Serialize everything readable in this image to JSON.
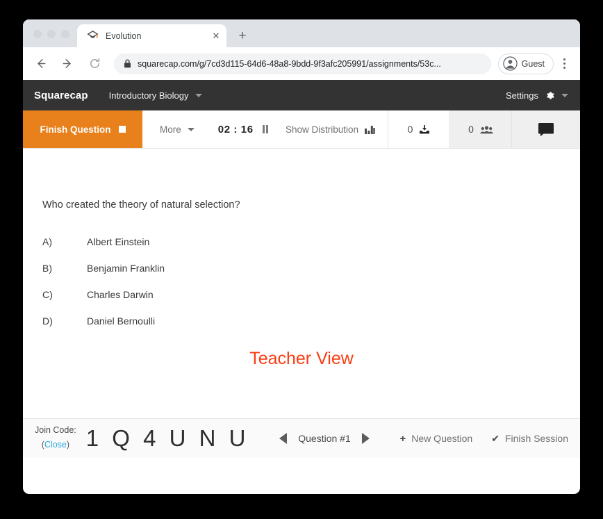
{
  "browser": {
    "tab": {
      "title": "Evolution",
      "favicon_name": "squarecap-cap-icon",
      "close_label": "✕"
    },
    "new_tab_label": "+",
    "nav": {
      "back_name": "back-icon",
      "forward_name": "forward-icon",
      "reload_name": "reload-icon"
    },
    "address": {
      "lock_name": "lock-icon",
      "url": "squarecap.com/g/7cd3d115-64d6-48a8-9bdd-9f3afc205991/assignments/53c..."
    },
    "profile": {
      "label": "Guest",
      "avatar_name": "person-avatar-icon"
    },
    "menu_name": "kebab-menu-icon"
  },
  "navbar": {
    "brand": "Squarecap",
    "course": "Introductory Biology",
    "settings_label": "Settings",
    "gear_name": "gear-icon"
  },
  "toolbar": {
    "finish_question_label": "Finish Question",
    "stop_icon_name": "stop-square-icon",
    "more_label": "More",
    "timer": "02 : 16",
    "pause_icon_name": "pause-icon",
    "show_distribution_label": "Show Distribution",
    "distribution_icon_name": "bar-chart-icon",
    "responses_count": "0",
    "responses_icon_name": "inbox-download-icon",
    "participants_count": "0",
    "participants_icon_name": "people-icon",
    "chat_icon_name": "chat-bubble-icon"
  },
  "question": {
    "prompt": "Who created the theory of natural selection?",
    "options": [
      {
        "letter": "A)",
        "text": "Albert Einstein"
      },
      {
        "letter": "B)",
        "text": "Benjamin Franklin"
      },
      {
        "letter": "C)",
        "text": "Charles Darwin"
      },
      {
        "letter": "D)",
        "text": "Daniel Bernoulli"
      }
    ],
    "annotation": "Teacher View"
  },
  "footer": {
    "join_code_label": "Join Code:",
    "join_code_close_open": "(",
    "join_code_close_link": "Close",
    "join_code_close_end": ")",
    "join_code_value": "1 Q 4 U N U",
    "prev_icon_name": "previous-question-icon",
    "question_number": "Question #1",
    "next_icon_name": "next-question-icon",
    "new_question_plus": "+",
    "new_question_label": "New Question",
    "finish_session_check": "✔",
    "finish_session_label": "Finish Session"
  },
  "colors": {
    "accent_orange": "#e8801b",
    "navbar_dark": "#333333",
    "annotation_red": "#fa3c13",
    "link_blue": "#29abe2"
  }
}
